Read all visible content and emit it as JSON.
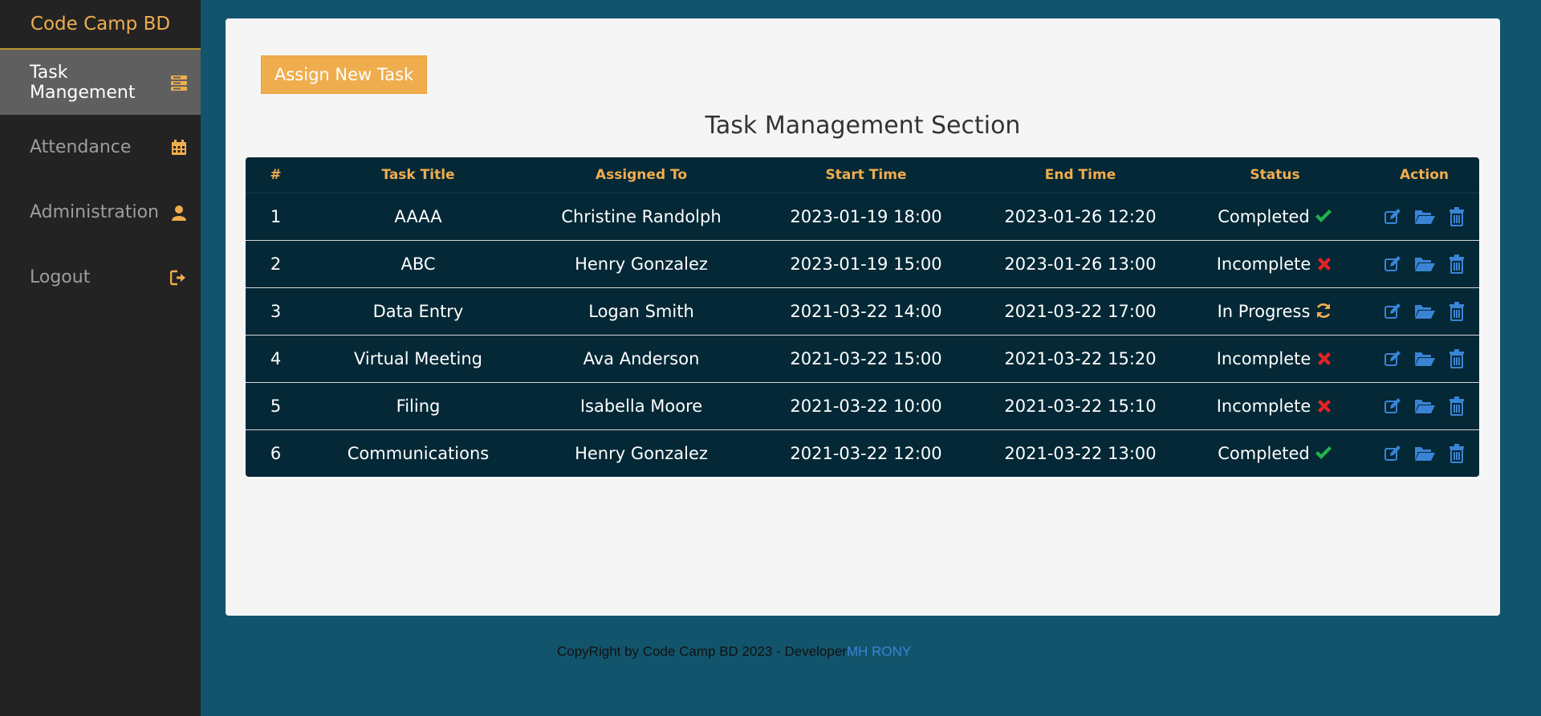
{
  "sidebar": {
    "brand": "Code Camp BD",
    "items": [
      {
        "label": "Task Mangement",
        "icon": "tasks-icon",
        "active": true
      },
      {
        "label": "Attendance",
        "icon": "calendar-icon",
        "active": false
      },
      {
        "label": "Administration",
        "icon": "user-icon",
        "active": false
      },
      {
        "label": "Logout",
        "icon": "logout-icon",
        "active": false
      }
    ]
  },
  "main": {
    "assign_label": "Assign New Task",
    "title": "Task Management Section",
    "columns": [
      "#",
      "Task Title",
      "Assigned To",
      "Start Time",
      "End Time",
      "Status",
      "Action"
    ],
    "rows": [
      {
        "num": "1",
        "title": "AAAA",
        "assigned": "Christine Randolph",
        "start": "2023-01-19 18:00",
        "end": "2023-01-26 12:20",
        "status": "Completed",
        "status_icon": "check-icon"
      },
      {
        "num": "2",
        "title": "ABC",
        "assigned": "Henry Gonzalez",
        "start": "2023-01-19 15:00",
        "end": "2023-01-26 13:00",
        "status": "Incomplete",
        "status_icon": "cross-icon"
      },
      {
        "num": "3",
        "title": "Data Entry",
        "assigned": "Logan Smith",
        "start": "2021-03-22 14:00",
        "end": "2021-03-22 17:00",
        "status": "In Progress",
        "status_icon": "refresh-icon"
      },
      {
        "num": "4",
        "title": "Virtual Meeting",
        "assigned": "Ava Anderson",
        "start": "2021-03-22 15:00",
        "end": "2021-03-22 15:20",
        "status": "Incomplete",
        "status_icon": "cross-icon"
      },
      {
        "num": "5",
        "title": "Filing",
        "assigned": "Isabella Moore",
        "start": "2021-03-22 10:00",
        "end": "2021-03-22 15:10",
        "status": "Incomplete",
        "status_icon": "cross-icon"
      },
      {
        "num": "6",
        "title": "Communications",
        "assigned": "Henry Gonzalez",
        "start": "2021-03-22 12:00",
        "end": "2021-03-22 13:00",
        "status": "Completed",
        "status_icon": "check-icon"
      }
    ]
  },
  "footer": {
    "text": "CopyRight by Code Camp BD 2023 - Developer",
    "developer": "MH RONY"
  },
  "colors": {
    "accent": "#f0ad4e",
    "page_bg": "#12546b",
    "table_bg": "#042836",
    "link": "#3a84d6",
    "check": "#22b14c",
    "cross": "#e02424"
  }
}
